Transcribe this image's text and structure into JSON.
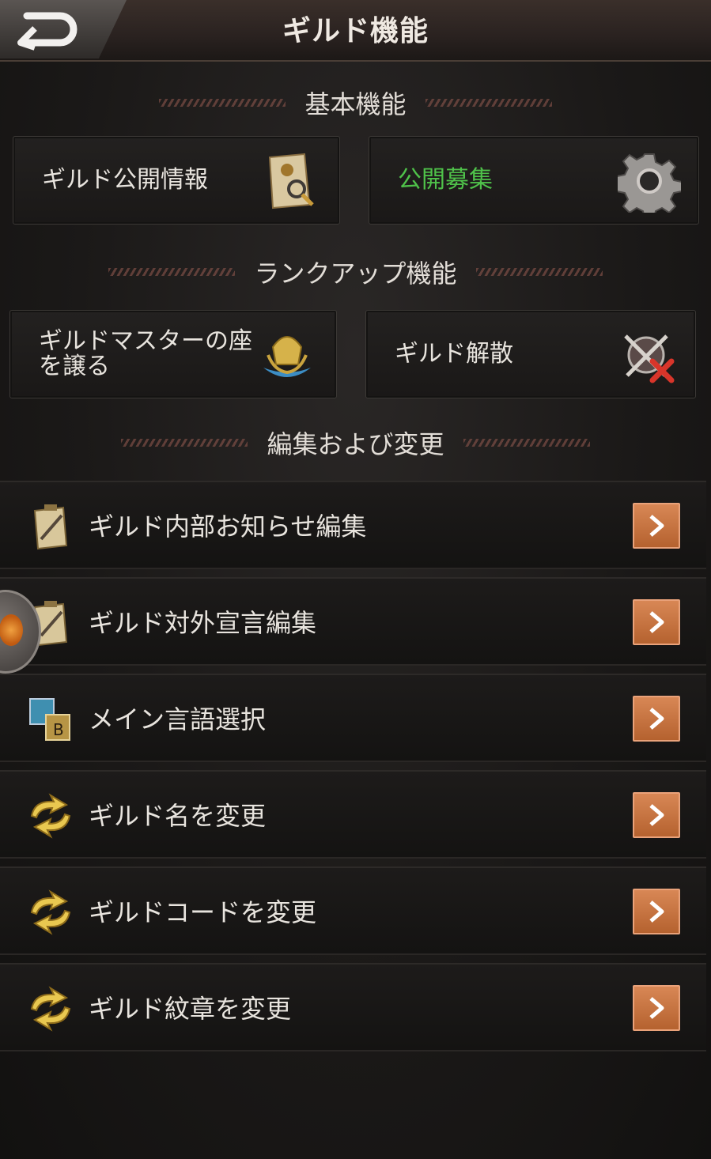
{
  "header": {
    "title": "ギルド機能"
  },
  "sections": {
    "basic": {
      "title": "基本機能"
    },
    "rankup": {
      "title": "ランクアップ機能"
    },
    "edit": {
      "title": "編集および変更"
    }
  },
  "cards": {
    "public_info": {
      "label": "ギルド公開情報",
      "icon": "scroll-magnifier-icon"
    },
    "public_recruit": {
      "label": "公開募集",
      "icon": "gear-icon",
      "color": "#4fc24a"
    },
    "transfer_master_line1": "ギルドマスターの座",
    "transfer_master_line2": "を譲る",
    "disband": {
      "label": "ギルド解散",
      "icon": "crossed-swords-icon"
    }
  },
  "menu_items": [
    {
      "label": "ギルド内部お知らせ編集",
      "icon": "clipboard-pen-icon"
    },
    {
      "label": "ギルド対外宣言編集",
      "icon": "clipboard-pen-icon"
    },
    {
      "label": "メイン言語選択",
      "icon": "language-ab-icon"
    },
    {
      "label": "ギルド名を変更",
      "icon": "swap-arrows-icon"
    },
    {
      "label": "ギルドコードを変更",
      "icon": "swap-arrows-icon"
    },
    {
      "label": "ギルド紋章を変更",
      "icon": "swap-arrows-icon"
    }
  ],
  "colors": {
    "accent_orange": "#c8713f",
    "recruit_green": "#4fc24a"
  }
}
